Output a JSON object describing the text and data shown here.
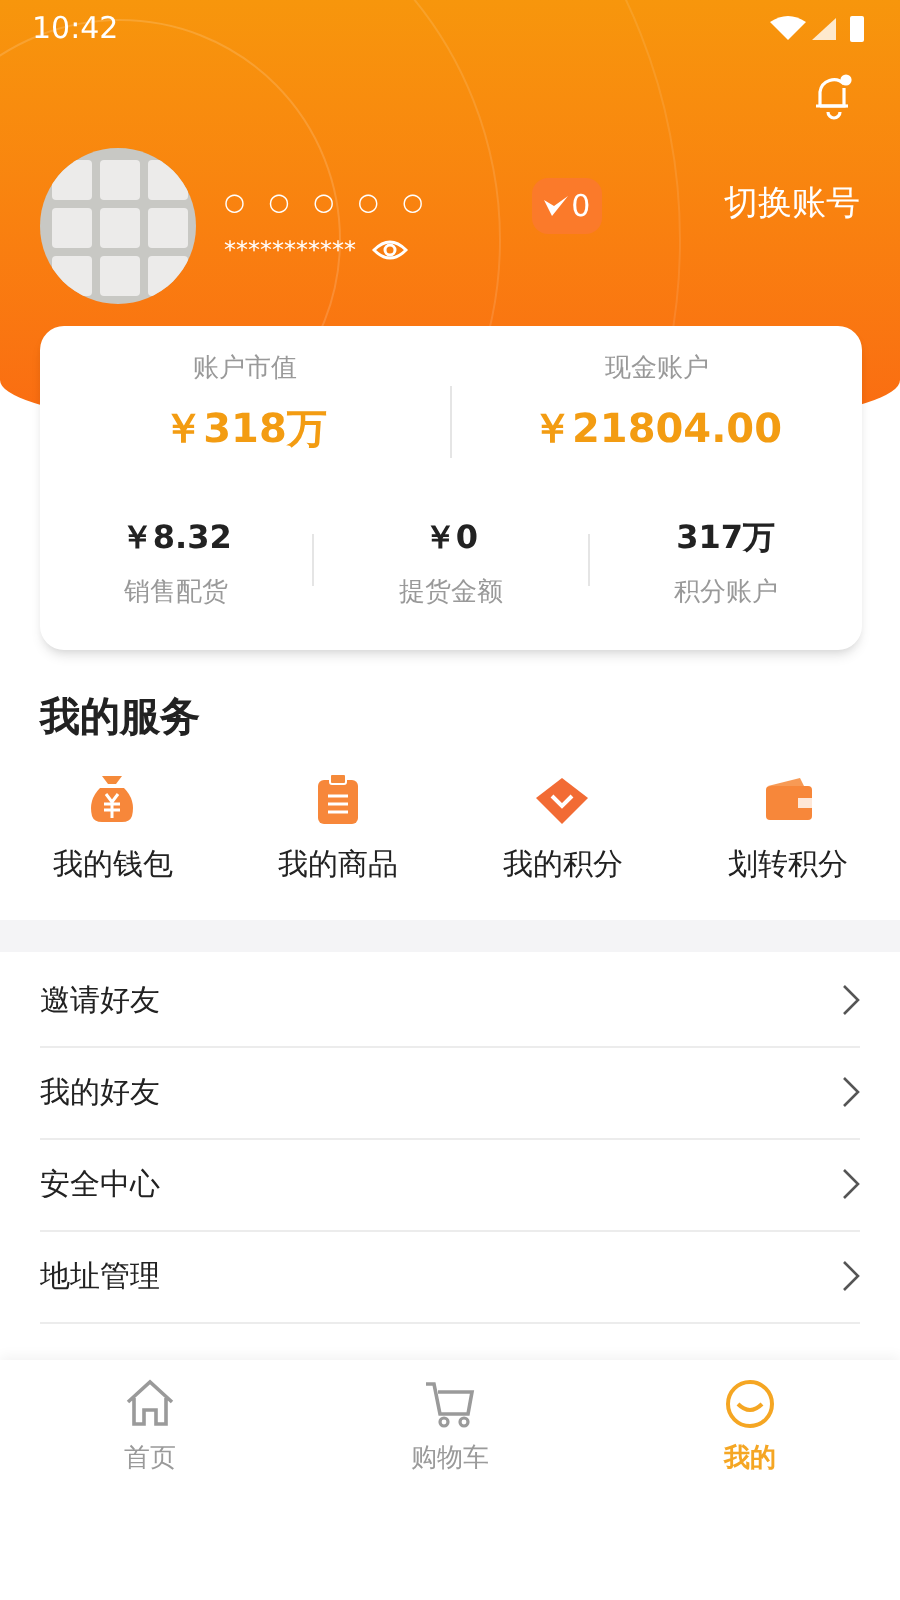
{
  "status_bar": {
    "time": "10:42"
  },
  "profile": {
    "nickname": "○ ○ ○ ○ ○",
    "account": "***********",
    "level_badge": "0",
    "switch_account": "切换账号"
  },
  "balances": {
    "top": [
      {
        "label": "账户市值",
        "value": "￥318万"
      },
      {
        "label": "现金账户",
        "value": "￥21804.00"
      }
    ],
    "bottom": [
      {
        "value": "￥8.32",
        "label": "销售配货"
      },
      {
        "value": "￥0",
        "label": "提货金额"
      },
      {
        "value": "317万",
        "label": "积分账户"
      }
    ]
  },
  "services": {
    "title": "我的服务",
    "items": [
      {
        "kind": "moneybag",
        "label": "我的钱包"
      },
      {
        "kind": "clipboard",
        "label": "我的商品"
      },
      {
        "kind": "gem",
        "label": "我的积分"
      },
      {
        "kind": "wallet",
        "label": "划转积分"
      }
    ]
  },
  "menu": [
    {
      "label": "邀请好友"
    },
    {
      "label": "我的好友"
    },
    {
      "label": "安全中心"
    },
    {
      "label": "地址管理"
    }
  ],
  "tab_bar": [
    {
      "kind": "home",
      "label": "首页",
      "selected": false
    },
    {
      "kind": "cart",
      "label": "购物车",
      "selected": false
    },
    {
      "kind": "me",
      "label": "我的",
      "selected": true
    }
  ]
}
